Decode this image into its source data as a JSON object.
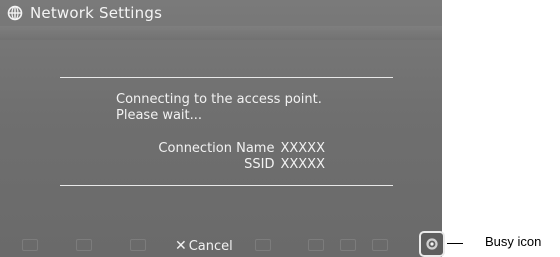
{
  "titlebar": {
    "title": "Network Settings",
    "icon": "globe-network-icon"
  },
  "message": {
    "line1": "Connecting to the access point.",
    "line2": "Please wait..."
  },
  "info": {
    "connection_label": "Connection Name",
    "connection_value": "XXXXX",
    "ssid_label": "SSID",
    "ssid_value": "XXXXX"
  },
  "footer": {
    "cancel_symbol": "✕",
    "cancel_label": "Cancel",
    "busy_icon": "busy-icon"
  },
  "annotation": {
    "label": "Busy icon"
  },
  "colors": {
    "screen_bg": "#707070",
    "text": "#f2f2f2"
  }
}
